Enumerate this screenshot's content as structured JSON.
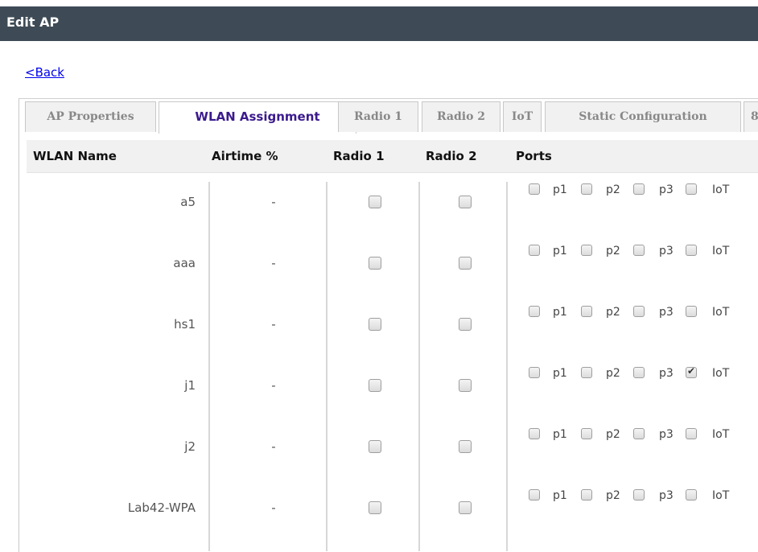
{
  "header": {
    "title": "Edit AP"
  },
  "nav": {
    "back_label": "<Back"
  },
  "tabs": [
    {
      "label": "AP Properties",
      "active": false
    },
    {
      "label": "WLAN Assignment",
      "active": true
    },
    {
      "label": "Radio 1",
      "active": false
    },
    {
      "label": "Radio 2",
      "active": false
    },
    {
      "label": "IoT",
      "active": false
    },
    {
      "label": "Static Configuration",
      "active": false
    },
    {
      "label": "8",
      "active": false
    }
  ],
  "table": {
    "headers": {
      "wlan_name": "WLAN Name",
      "airtime": "Airtime %",
      "radio1": "Radio 1",
      "radio2": "Radio 2",
      "ports": "Ports"
    },
    "rows": [
      {
        "name": "a5",
        "airtime": "-",
        "radio1": false,
        "radio2": false,
        "ports": {
          "p1": false,
          "p2": false,
          "p3": false,
          "iot": false
        }
      },
      {
        "name": "aaa",
        "airtime": "-",
        "radio1": false,
        "radio2": false,
        "ports": {
          "p1": false,
          "p2": false,
          "p3": false,
          "iot": false
        }
      },
      {
        "name": "hs1",
        "airtime": "-",
        "radio1": false,
        "radio2": false,
        "ports": {
          "p1": false,
          "p2": false,
          "p3": false,
          "iot": false
        }
      },
      {
        "name": "j1",
        "airtime": "-",
        "radio1": false,
        "radio2": false,
        "ports": {
          "p1": false,
          "p2": false,
          "p3": false,
          "iot": true
        }
      },
      {
        "name": "j2",
        "airtime": "-",
        "radio1": false,
        "radio2": false,
        "ports": {
          "p1": false,
          "p2": false,
          "p3": false,
          "iot": false
        }
      },
      {
        "name": "Lab42-WPA",
        "airtime": "-",
        "radio1": false,
        "radio2": false,
        "ports": {
          "p1": false,
          "p2": false,
          "p3": false,
          "iot": false
        }
      }
    ],
    "port_labels": {
      "p1": "p1",
      "p2": "p2",
      "p3": "p3",
      "iot": "IoT"
    }
  }
}
